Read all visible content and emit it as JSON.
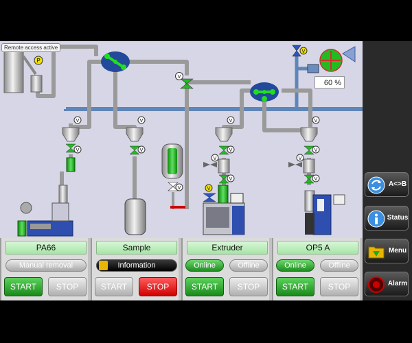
{
  "remote_access_label": "Remote access active",
  "process": {
    "valve_label": "V",
    "pump_label": "P",
    "fan_output_percent": "60 %",
    "colors": {
      "background": "#d6d6e6",
      "pipe": "#9a9a9a",
      "water_pipe": "#5f86b8",
      "active": "#22bb22",
      "valve_yellow": "#f0e000"
    }
  },
  "sidebar": {
    "items": [
      {
        "label": "A<>B",
        "icon": "swap-arrows-icon"
      },
      {
        "label": "Status",
        "icon": "info-icon"
      },
      {
        "label": "Menu",
        "icon": "folder-icon"
      },
      {
        "label": "Alarm",
        "icon": "alarm-beacon-icon"
      }
    ]
  },
  "units": [
    {
      "name": "PA66",
      "mode": "Manual removal",
      "start_label": "START",
      "stop_label": "STOP",
      "start_state": "active",
      "stop_state": "inactive"
    },
    {
      "name": "Sample",
      "mode": "Information",
      "start_label": "START",
      "stop_label": "STOP",
      "start_state": "inactive",
      "stop_state": "alarm"
    },
    {
      "name": "Extruder",
      "online_label": "Online",
      "offline_label": "Offline",
      "online_state": "active",
      "start_label": "START",
      "stop_label": "STOP",
      "start_state": "active",
      "stop_state": "inactive"
    },
    {
      "name": "OP5 A",
      "online_label": "Online",
      "offline_label": "Offline",
      "online_state": "active",
      "start_label": "START",
      "stop_label": "STOP",
      "start_state": "active",
      "stop_state": "inactive"
    }
  ]
}
